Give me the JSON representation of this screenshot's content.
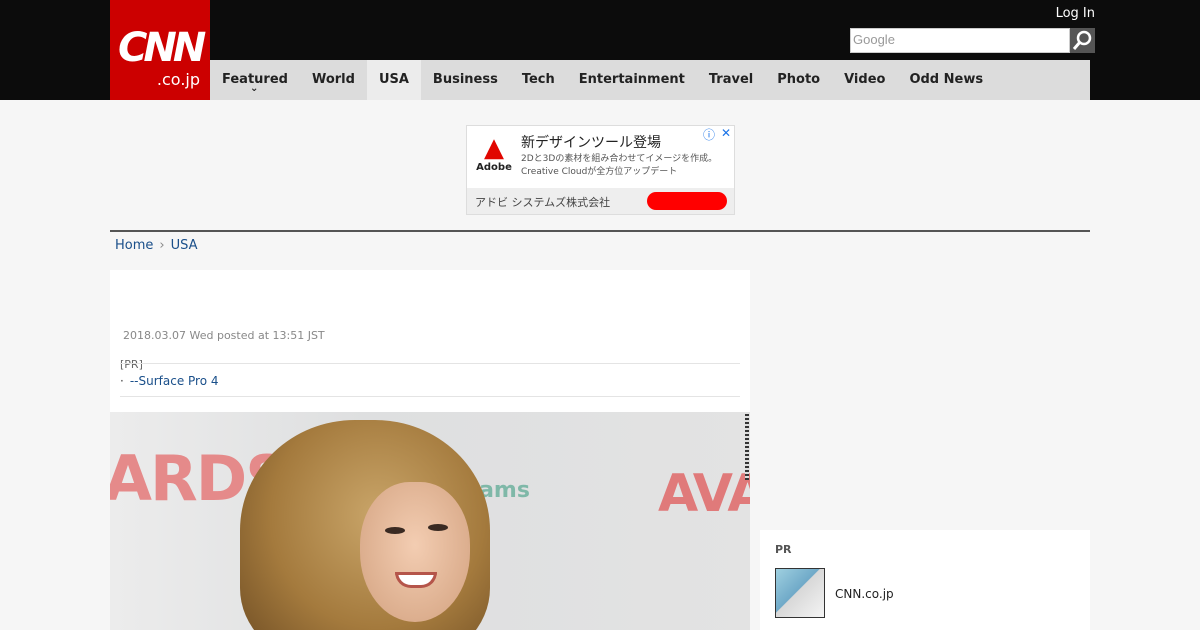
{
  "header": {
    "logo_main": "CNN",
    "logo_sub": ".co.jp",
    "login": "Log In",
    "search_placeholder": "Google"
  },
  "nav": {
    "items": [
      {
        "label": "Featured"
      },
      {
        "label": "World"
      },
      {
        "label": "USA"
      },
      {
        "label": "Business"
      },
      {
        "label": "Tech"
      },
      {
        "label": "Entertainment"
      },
      {
        "label": "Travel"
      },
      {
        "label": "Photo"
      },
      {
        "label": "Video"
      },
      {
        "label": "Odd News"
      }
    ],
    "active": "USA"
  },
  "ad": {
    "brand": "Adobe",
    "title": "新デザインツール登場",
    "description": "2Dと3Dの素材を組み合わせてイメージを作成。Creative Cloudが全方位アップデート",
    "company": "アドビ システムズ株式会社",
    "cta_color": "#ff0000"
  },
  "breadcrumb": [
    {
      "label": "Home"
    },
    {
      "label": "USA"
    }
  ],
  "article": {
    "date": "2018.03.07 Wed posted at 13:51 JST",
    "pr_label": "[PR]",
    "pr_link": "--Surface Pro 4"
  },
  "photo": {
    "backdrop_text_left": "ARDS",
    "backdrop_text_mid": "eCams",
    "backdrop_text_right": "AVA"
  },
  "sidebar_pr": {
    "label": "PR",
    "item_text": "CNN.co.jp"
  },
  "colors": {
    "brand_red": "#cc0000",
    "header_bg": "#0c0c0c",
    "nav_bg": "#dcdcdc",
    "link": "#1a4f8a"
  }
}
